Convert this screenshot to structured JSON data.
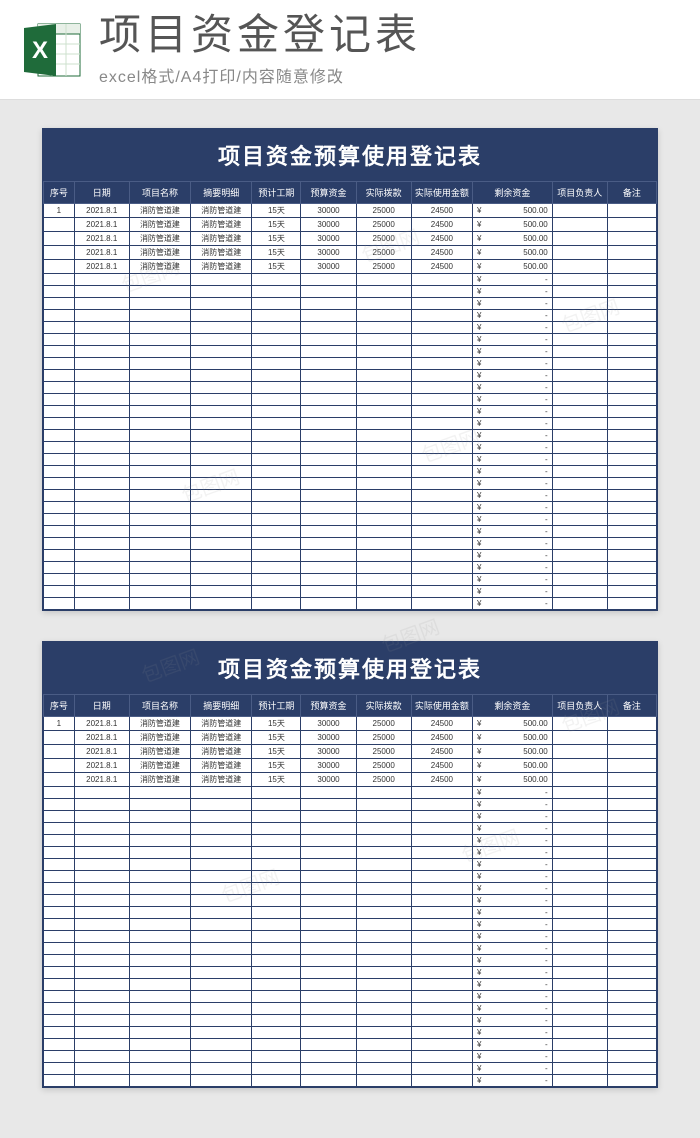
{
  "header": {
    "main_title": "项目资金登记表",
    "subtitle": "excel格式/A4打印/内容随意修改"
  },
  "sheet": {
    "title": "项目资金预算使用登记表",
    "columns": [
      "序号",
      "日期",
      "项目名称",
      "摘要明细",
      "预计工期",
      "预算资金",
      "实际拨款",
      "实际使用金额",
      "剩余资金",
      "项目负责人",
      "备注"
    ],
    "data_rows": [
      {
        "seq": "1",
        "date": "2021.8.1",
        "name": "消防管道建",
        "detail": "消防管道建",
        "period": "15天",
        "budget": "30000",
        "alloc": "25000",
        "used": "24500",
        "remain": "500.00",
        "owner": "",
        "note": ""
      },
      {
        "seq": "",
        "date": "2021.8.1",
        "name": "消防管道建",
        "detail": "消防管道建",
        "period": "15天",
        "budget": "30000",
        "alloc": "25000",
        "used": "24500",
        "remain": "500.00",
        "owner": "",
        "note": ""
      },
      {
        "seq": "",
        "date": "2021.8.1",
        "name": "消防管道建",
        "detail": "消防管道建",
        "period": "15天",
        "budget": "30000",
        "alloc": "25000",
        "used": "24500",
        "remain": "500.00",
        "owner": "",
        "note": ""
      },
      {
        "seq": "",
        "date": "2021.8.1",
        "name": "消防管道建",
        "detail": "消防管道建",
        "period": "15天",
        "budget": "30000",
        "alloc": "25000",
        "used": "24500",
        "remain": "500.00",
        "owner": "",
        "note": ""
      },
      {
        "seq": "",
        "date": "2021.8.1",
        "name": "消防管道建",
        "detail": "消防管道建",
        "period": "15天",
        "budget": "30000",
        "alloc": "25000",
        "used": "24500",
        "remain": "500.00",
        "owner": "",
        "note": ""
      }
    ],
    "empty_row_remain": "-",
    "currency": "¥"
  },
  "first_sheet_empty_rows": 28,
  "second_sheet_empty_rows": 25,
  "watermark_text": "包图网"
}
